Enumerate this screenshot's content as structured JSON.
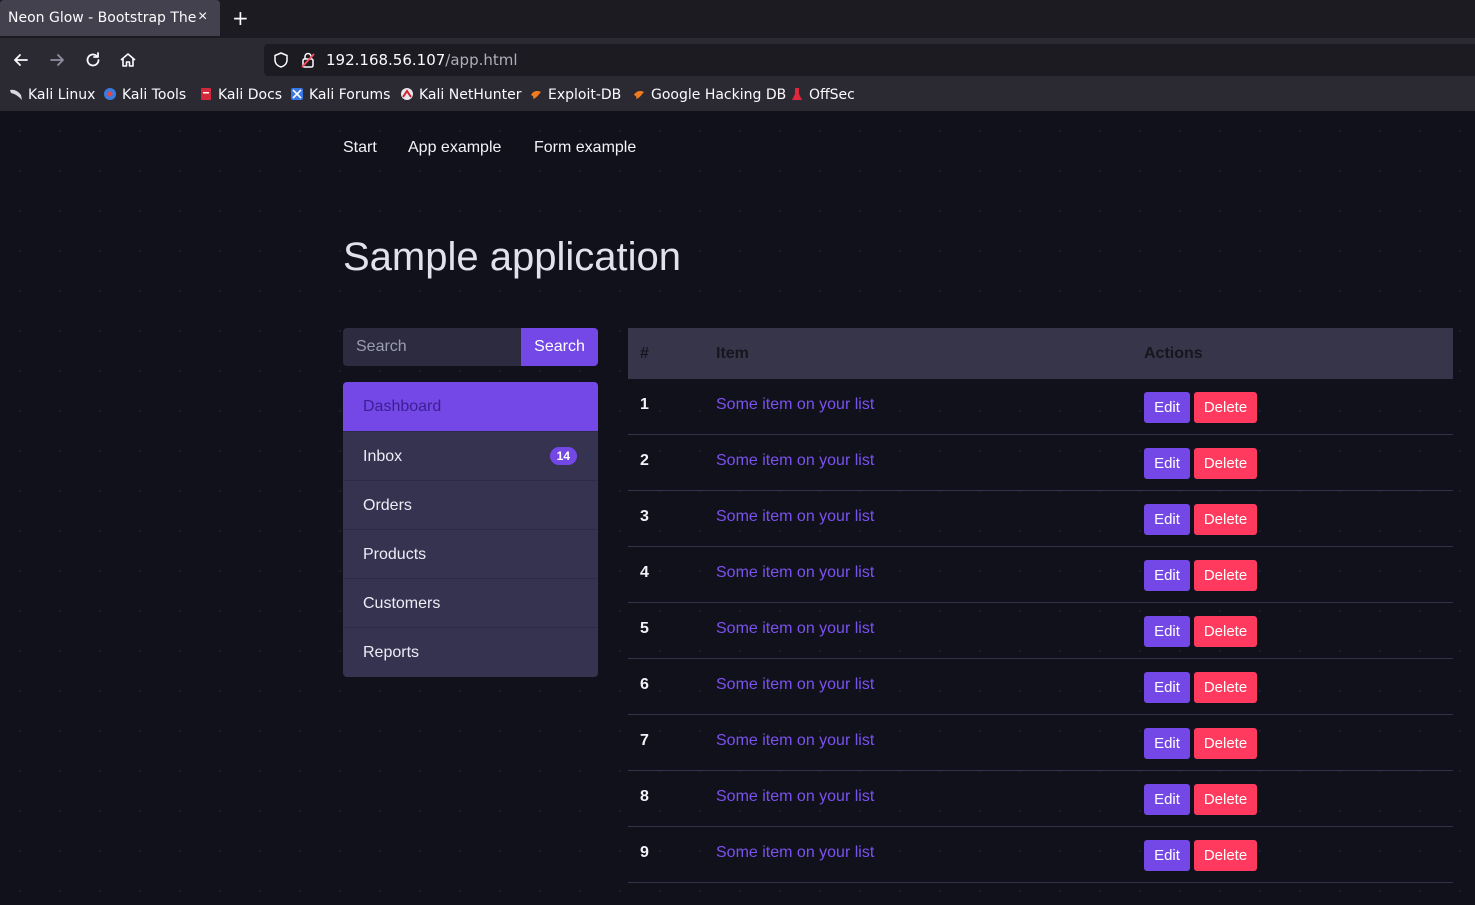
{
  "browser": {
    "tab_title": "Neon Glow - Bootstrap Theme",
    "tab_close": "×",
    "new_tab": "+",
    "url_host": "192.168.56.107",
    "url_path": "/app.html",
    "bookmarks": [
      {
        "label": "Kali Linux",
        "icon": "kali-dragon-icon"
      },
      {
        "label": "Kali Tools",
        "icon": "kali-tools-icon"
      },
      {
        "label": "Kali Docs",
        "icon": "kali-docs-icon"
      },
      {
        "label": "Kali Forums",
        "icon": "kali-forums-icon"
      },
      {
        "label": "Kali NetHunter",
        "icon": "nethunter-icon"
      },
      {
        "label": "Exploit-DB",
        "icon": "exploit-db-icon"
      },
      {
        "label": "Google Hacking DB",
        "icon": "ghdb-icon"
      },
      {
        "label": "OffSec",
        "icon": "offsec-icon"
      }
    ]
  },
  "topnav": {
    "start": "Start",
    "app_example": "App example",
    "form_example": "Form example"
  },
  "page_title": "Sample application",
  "search": {
    "placeholder": "Search",
    "button_label": "Search"
  },
  "sidebar": {
    "items": [
      {
        "label": "Dashboard",
        "active": true
      },
      {
        "label": "Inbox",
        "badge": "14"
      },
      {
        "label": "Orders"
      },
      {
        "label": "Products"
      },
      {
        "label": "Customers"
      },
      {
        "label": "Reports"
      }
    ]
  },
  "table": {
    "headers": {
      "num": "#",
      "item": "Item",
      "actions": "Actions"
    },
    "edit_label": "Edit",
    "delete_label": "Delete",
    "rows": [
      {
        "num": "1",
        "item": "Some item on your list"
      },
      {
        "num": "2",
        "item": "Some item on your list"
      },
      {
        "num": "3",
        "item": "Some item on your list"
      },
      {
        "num": "4",
        "item": "Some item on your list"
      },
      {
        "num": "5",
        "item": "Some item on your list"
      },
      {
        "num": "6",
        "item": "Some item on your list"
      },
      {
        "num": "7",
        "item": "Some item on your list"
      },
      {
        "num": "8",
        "item": "Some item on your list"
      },
      {
        "num": "9",
        "item": "Some item on your list"
      }
    ]
  },
  "colors": {
    "accent": "#7448e6",
    "danger": "#ff3a5e",
    "background": "#11111c"
  }
}
